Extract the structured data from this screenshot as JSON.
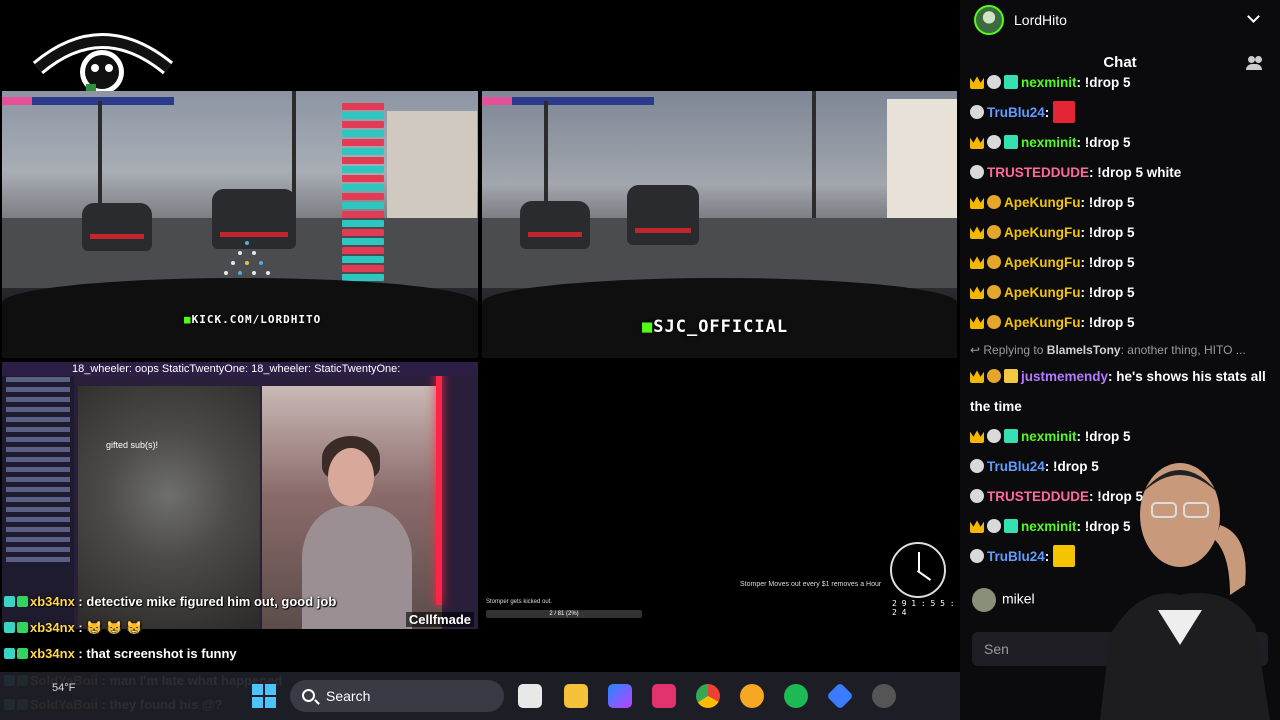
{
  "panel": {
    "channel_name": "LordHito",
    "chat_title": "Chat",
    "viewer_name": "mikel",
    "send_placeholder": "Sen"
  },
  "chat": [
    {
      "name": "nexminit",
      "name_color": "green",
      "badges": [
        "crown",
        "man",
        "gem"
      ],
      "text": "!drop 5",
      "partial": true
    },
    {
      "name": "TruBlu24",
      "name_color": "blue",
      "badges": [
        "man"
      ],
      "text": "",
      "emote": "red"
    },
    {
      "name": "nexminit",
      "name_color": "green",
      "badges": [
        "crown",
        "man",
        "gem"
      ],
      "text": "!drop 5"
    },
    {
      "name": "TRUSTEDDUDE",
      "name_color": "pink",
      "badges": [
        "man"
      ],
      "text": "!drop 5 white"
    },
    {
      "name": "ApeKungFu",
      "name_color": "gold",
      "badges": [
        "crown",
        "gold"
      ],
      "text": "!drop 5"
    },
    {
      "name": "ApeKungFu",
      "name_color": "gold",
      "badges": [
        "crown",
        "gold"
      ],
      "text": "!drop 5"
    },
    {
      "name": "ApeKungFu",
      "name_color": "gold",
      "badges": [
        "crown",
        "gold"
      ],
      "text": "!drop 5"
    },
    {
      "name": "ApeKungFu",
      "name_color": "gold",
      "badges": [
        "crown",
        "gold"
      ],
      "text": "!drop 5"
    },
    {
      "name": "ApeKungFu",
      "name_color": "gold",
      "badges": [
        "crown",
        "gold"
      ],
      "text": "!drop 5"
    },
    {
      "reply_prefix": "Replying to",
      "reply_to": "BlameIsTony",
      "reply_text": "another thing, HITO ..."
    },
    {
      "name": "justmemendy",
      "name_color": "purple",
      "badges": [
        "crown",
        "gold",
        "gift"
      ],
      "text": "he's shows his stats all the time",
      "wrap": true
    },
    {
      "name": "nexminit",
      "name_color": "green",
      "badges": [
        "crown",
        "man",
        "gem"
      ],
      "text": "!drop 5"
    },
    {
      "name": "TruBlu24",
      "name_color": "blue",
      "badges": [
        "man"
      ],
      "text": "!drop 5"
    },
    {
      "name": "TRUSTEDDUDE",
      "name_color": "pink",
      "badges": [
        "man"
      ],
      "text": "!drop 5 wl"
    },
    {
      "name": "nexminit",
      "name_color": "green",
      "badges": [
        "crown",
        "man",
        "gem"
      ],
      "text": "!drop 5"
    },
    {
      "name": "TruBlu24",
      "name_color": "blue",
      "badges": [
        "man"
      ],
      "text": "",
      "emote": "w"
    }
  ],
  "overlay_chat": [
    {
      "name": "xb34nx",
      "text": "detective mike figured him out, good job"
    },
    {
      "name": "xb34nx",
      "text": "😸 😸 😸"
    },
    {
      "name": "xb34nx",
      "text": "that screenshot is funny"
    },
    {
      "name": "SoldYaBoii",
      "text": "man I'm late what happened",
      "dim": true
    },
    {
      "name": "SoldYaBoii",
      "text": "they found his @?",
      "dim": true
    }
  ],
  "feeds": {
    "watermark_tl": "KICK.COM/LORDHITO",
    "watermark_tr": "SJC_OFFICIAL",
    "cam_bar": "18_wheeler: oops   StaticTwentyOne:   18_wheeler:   StaticTwentyOne:",
    "cam_gift": "gifted   sub(s)!",
    "cellf": "Cellfmade",
    "stomper": "Stomper Moves out every $1 removes a Hour",
    "clock_digits": "2 9 1 : 5 5 : 2 4",
    "kicked": "Stomper gets kicked out.",
    "progress": "2 / 81 (2%)"
  },
  "taskbar": {
    "weather": "54°F",
    "search_label": "Search"
  },
  "colors": {
    "kick_green": "#53fc18",
    "panel_bg": "#0b0b0e",
    "name_blue": "#5f9cff",
    "name_pink": "#ff6a9a",
    "name_gold": "#f5c400",
    "name_purple": "#b37bff"
  }
}
